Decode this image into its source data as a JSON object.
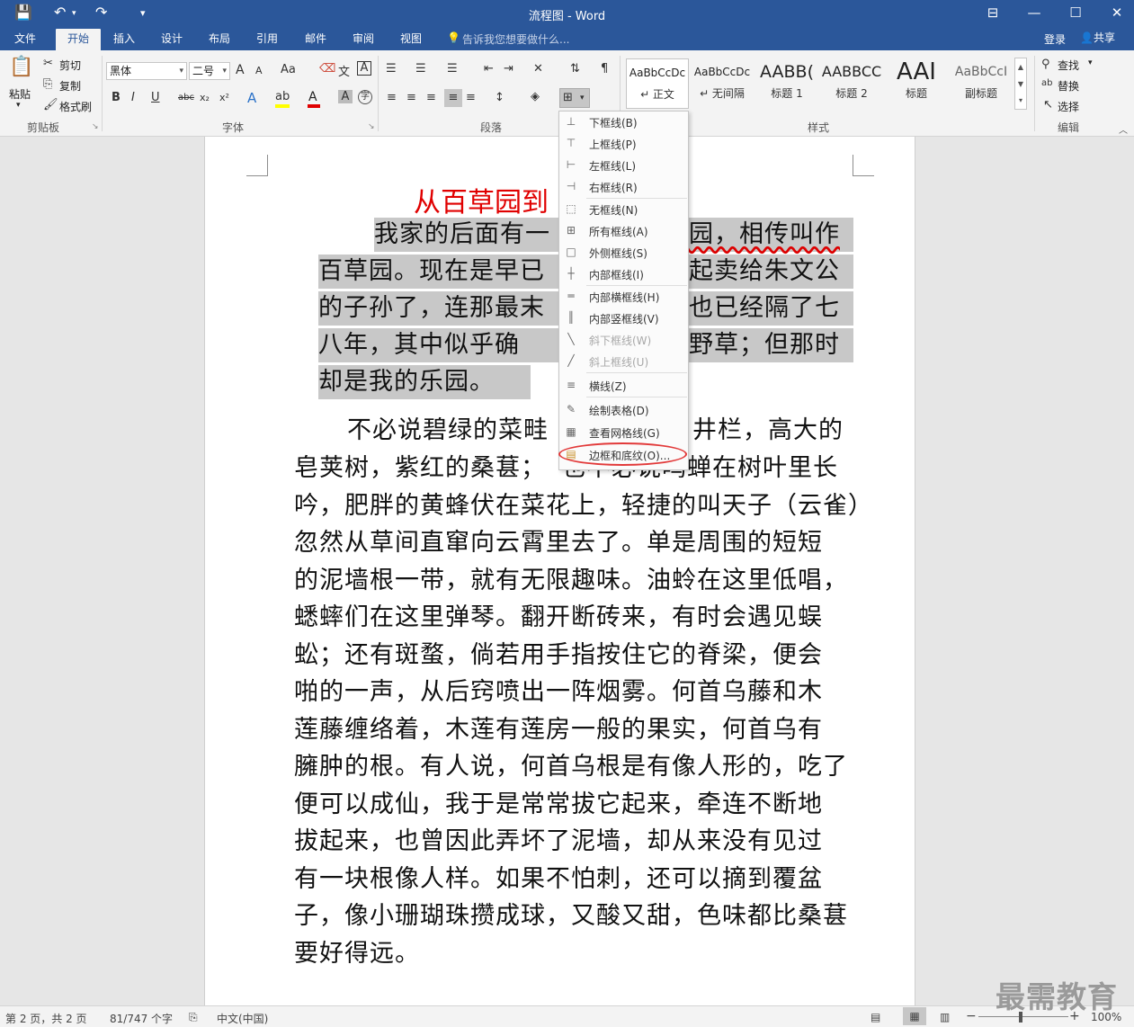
{
  "titlebar": {
    "title": "流程图 - Word",
    "save_icon": "💾",
    "undo_icon": "↶",
    "redo_icon": "↷",
    "customize_icon": "▾",
    "ribbon_display_icon": "⊟",
    "minimize_icon": "—",
    "maximize_icon": "☐",
    "close_icon": "✕"
  },
  "tabs": [
    "文件",
    "开始",
    "插入",
    "设计",
    "布局",
    "引用",
    "邮件",
    "审阅",
    "视图"
  ],
  "tell_me": "告诉我您想要做什么...",
  "login": "登录",
  "share": "共享",
  "clipboard": {
    "paste": "粘贴",
    "cut": "剪切",
    "copy": "复制",
    "format_painter": "格式刷",
    "label": "剪贴板"
  },
  "font": {
    "family": "黑体",
    "size": "二号",
    "label": "字体",
    "grow": "A",
    "shrink": "A",
    "case": "Aa",
    "bold": "B",
    "italic": "I",
    "underline": "U",
    "strike": "abc",
    "subscript": "x₂",
    "superscript": "x²"
  },
  "paragraph": {
    "label": "段落"
  },
  "styles": {
    "label": "样式",
    "items": [
      {
        "sample": "AaBbCcDc",
        "name": "↵ 正文"
      },
      {
        "sample": "AaBbCcDc",
        "name": "↵ 无间隔"
      },
      {
        "sample": "AABB(",
        "name": "标题 1"
      },
      {
        "sample": "AABBCC",
        "name": "标题 2"
      },
      {
        "sample": "AAI",
        "name": "标题"
      },
      {
        "sample": "AaBbCcI",
        "name": "副标题"
      }
    ]
  },
  "editing": {
    "find": "查找",
    "replace": "替换",
    "select": "选择",
    "label": "编辑"
  },
  "document": {
    "title": "从百草园到",
    "lines": [
      "我家的后面有一",
      "园，相传叫作",
      "百草园。现在是早已",
      "起卖给朱文公",
      "的子孙了，连那最末",
      "也已经隔了七",
      "八年，其中似乎确",
      "野草；但那时",
      "却是我的乐园。",
      "不必说碧绿的菜畦",
      "井栏，高大的",
      "皂荚树，紫红的桑葚；",
      "也不必说鸣蝉在树叶里长",
      "吟，肥胖的黄蜂伏在菜花上，轻捷的叫天子（云雀）",
      "忽然从草间直窜向云霄里去了。单是周围的短短",
      "的泥墙根一带，就有无限趣味。油蛉在这里低唱，",
      "蟋蟀们在这里弹琴。翻开断砖来，有时会遇见蜈",
      "蚣；还有斑蝥，倘若用手指按住它的脊梁，便会",
      "啪的一声，从后窍喷出一阵烟雾。何首乌藤和木",
      "莲藤缠络着，木莲有莲房一般的果实，何首乌有",
      "臃肿的根。有人说，何首乌根是有像人形的，吃了",
      "便可以成仙，我于是常常拔它起来，牵连不断地",
      "拔起来，也曾因此弄坏了泥墙，却从来没有见过",
      "有一块根像人样。如果不怕刺，还可以摘到覆盆",
      "子，像小珊瑚珠攒成球，又酸又甜，色味都比桑葚",
      "要好得远。"
    ]
  },
  "border_menu": {
    "items": [
      {
        "label": "下框线(B)",
        "icon": "⊥",
        "enabled": true
      },
      {
        "label": "上框线(P)",
        "icon": "⊤",
        "enabled": true
      },
      {
        "label": "左框线(L)",
        "icon": "⊢",
        "enabled": true
      },
      {
        "label": "右框线(R)",
        "icon": "⊣",
        "enabled": true
      },
      {
        "label": "无框线(N)",
        "icon": "⬚",
        "enabled": true
      },
      {
        "label": "所有框线(A)",
        "icon": "⊞",
        "enabled": true
      },
      {
        "label": "外侧框线(S)",
        "icon": "□",
        "enabled": true
      },
      {
        "label": "内部框线(I)",
        "icon": "┼",
        "enabled": true
      },
      {
        "label": "内部横框线(H)",
        "icon": "═",
        "enabled": true
      },
      {
        "label": "内部竖框线(V)",
        "icon": "║",
        "enabled": true
      },
      {
        "label": "斜下框线(W)",
        "icon": "╲",
        "enabled": false
      },
      {
        "label": "斜上框线(U)",
        "icon": "╱",
        "enabled": false
      },
      {
        "label": "横线(Z)",
        "icon": "≡",
        "enabled": true
      },
      {
        "label": "绘制表格(D)",
        "icon": "✎",
        "enabled": true
      },
      {
        "label": "查看网格线(G)",
        "icon": "▦",
        "enabled": true
      },
      {
        "label": "边框和底纹(O)...",
        "icon": "▤",
        "enabled": true
      }
    ]
  },
  "statusbar": {
    "page": "第 2 页，共 2 页",
    "words": "81/747 个字",
    "language": "中文(中国)",
    "zoom": "100%",
    "minus": "−",
    "plus": "+"
  },
  "watermark": "最需教育",
  "colors": {
    "accent": "#2b579a",
    "title_red": "#e00000",
    "highlight_gray": "#c8c8c8",
    "circle_red": "#e23a3a"
  }
}
